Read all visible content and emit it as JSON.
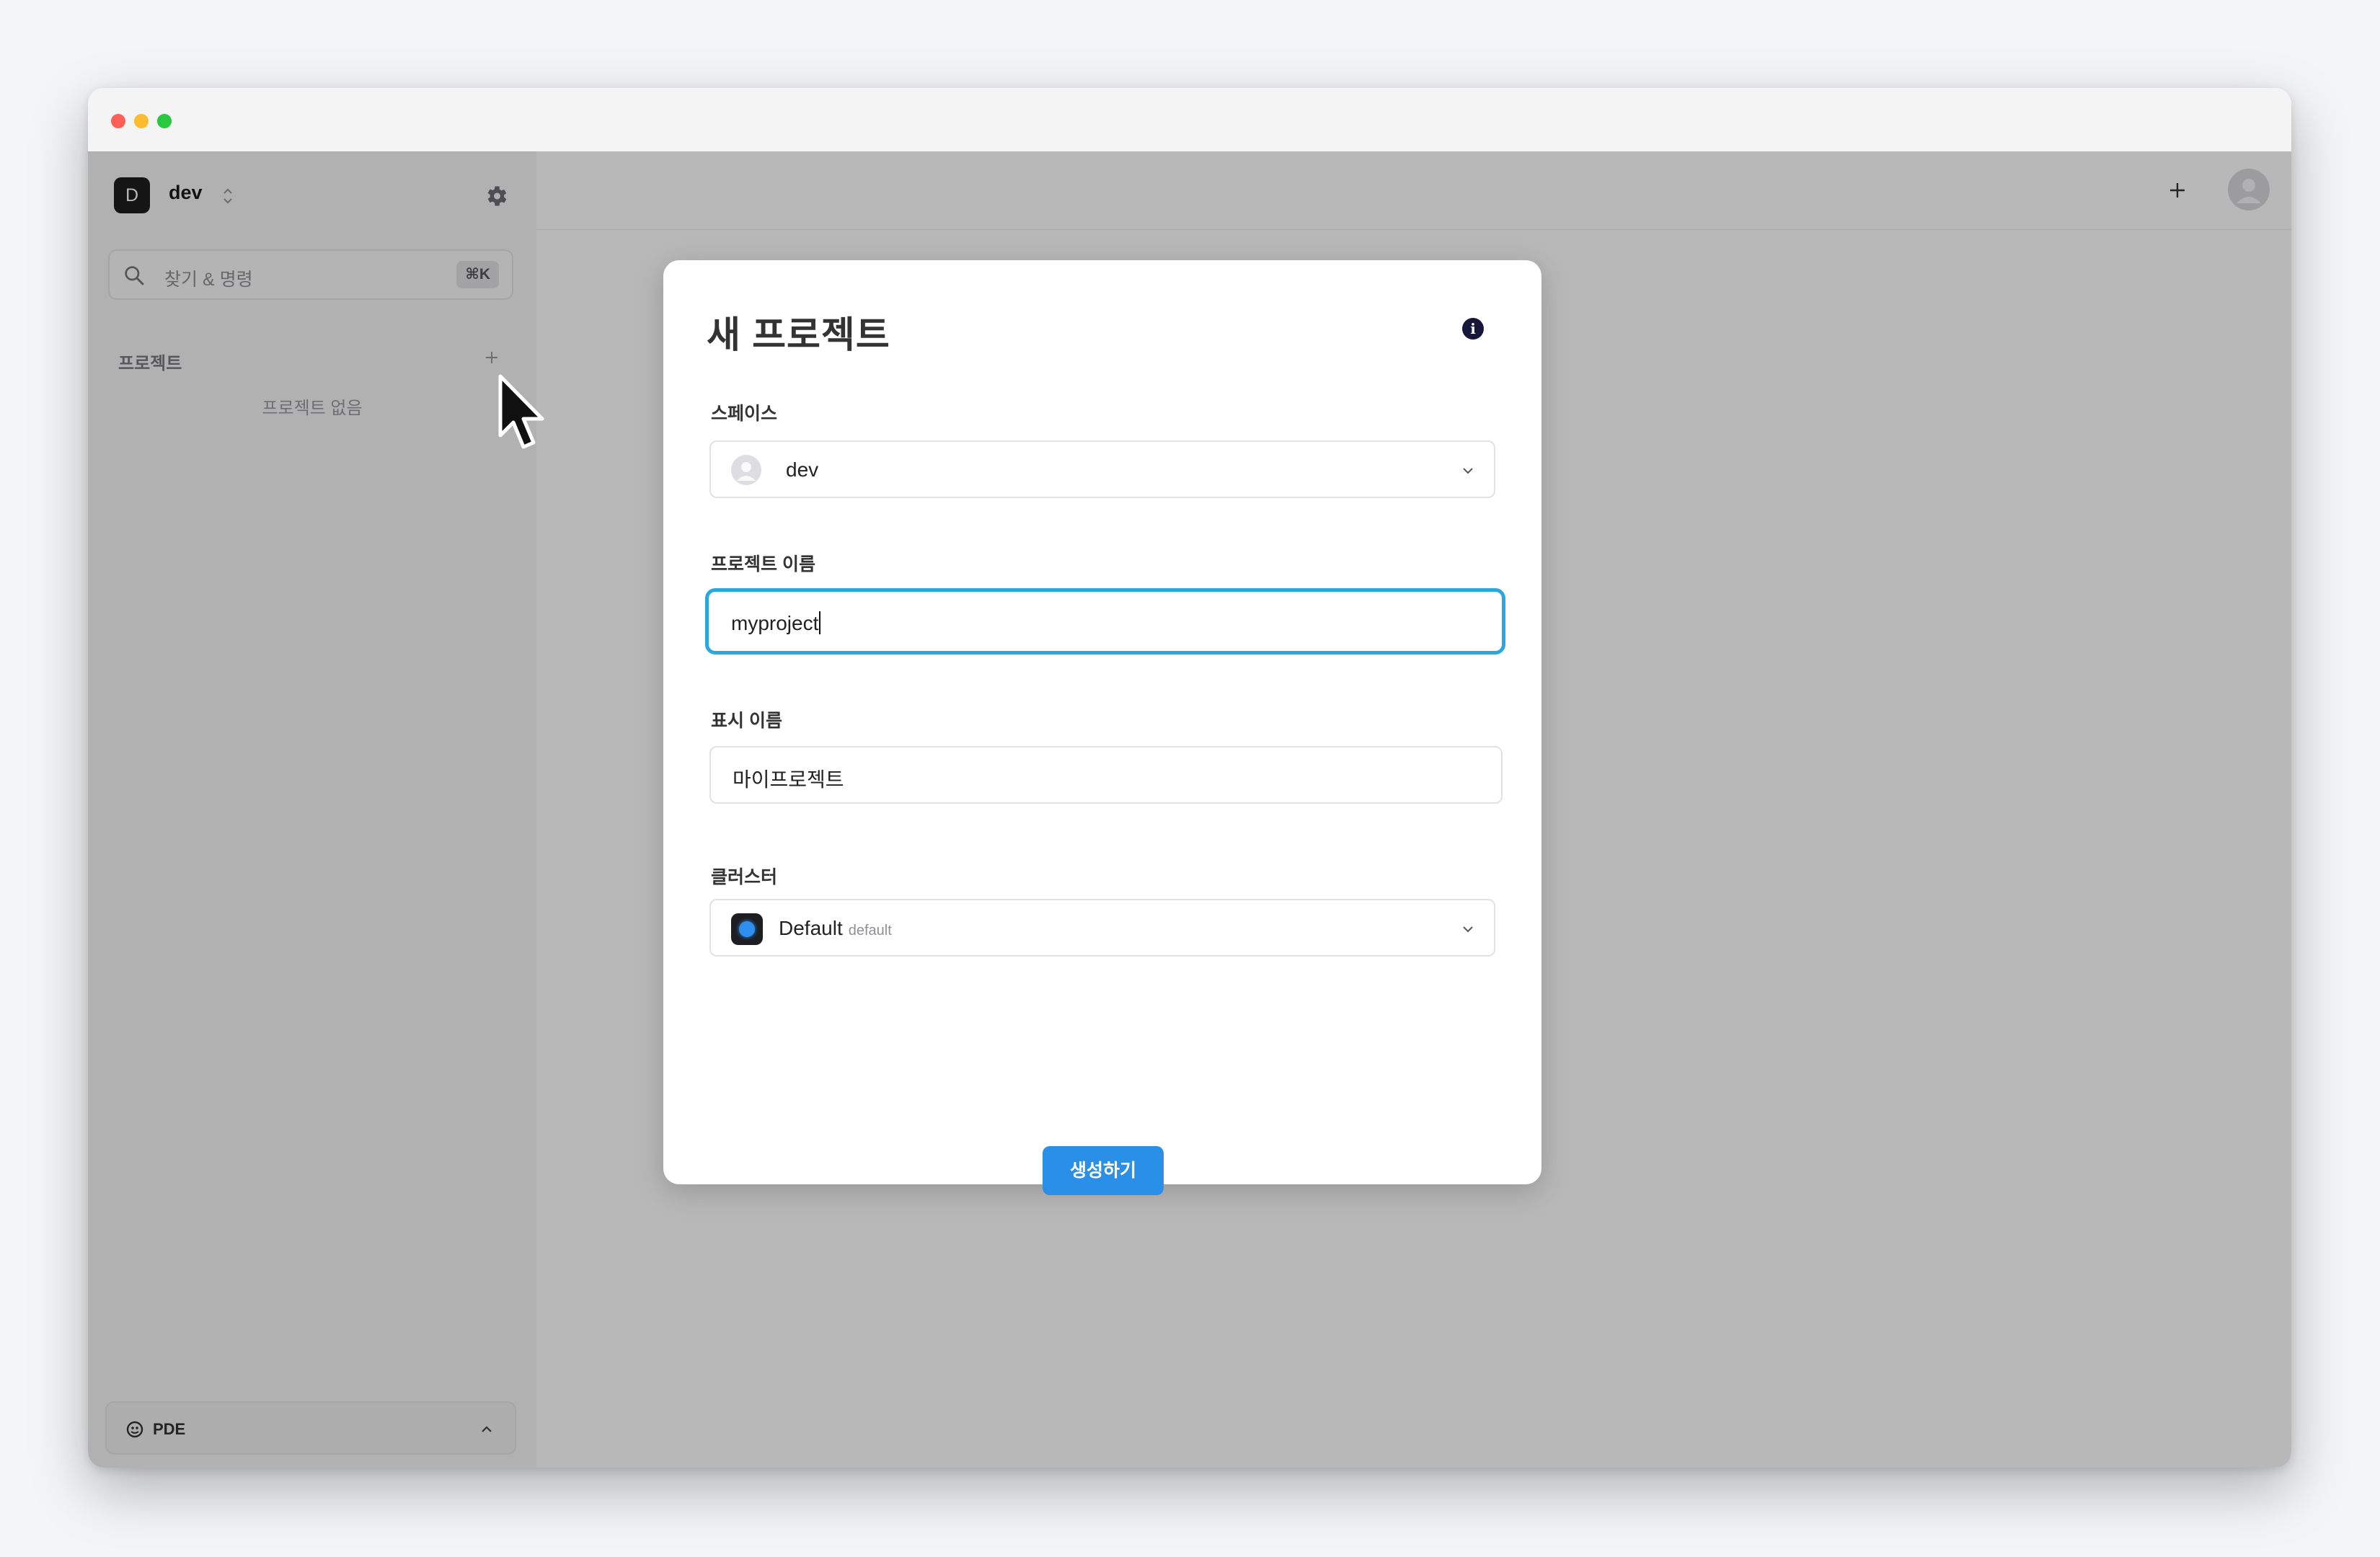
{
  "window": {
    "traffic_lights": [
      "close",
      "minimize",
      "zoom"
    ]
  },
  "sidebar": {
    "workspace_initial": "D",
    "workspace_name": "dev",
    "search_placeholder": "찾기 & 명령",
    "search_shortcut": "⌘K",
    "projects_title": "프로젝트",
    "projects_empty": "프로젝트 없음",
    "footer_label": "PDE"
  },
  "dialog": {
    "title": "새 프로젝트",
    "info_icon": "i",
    "space_label": "스페이스",
    "space_value": "dev",
    "project_name_label": "프로젝트 이름",
    "project_name_value": "myproject",
    "display_name_label": "표시 이름",
    "display_name_value": "마이프로젝트",
    "cluster_label": "클러스터",
    "cluster_value": "Default",
    "cluster_sub": "default",
    "create_button": "생성하기"
  },
  "colors": {
    "accent": "#2a8fe6",
    "focus_ring": "#2aa7dd",
    "overlay": "rgba(0,0,0,0.28)"
  }
}
